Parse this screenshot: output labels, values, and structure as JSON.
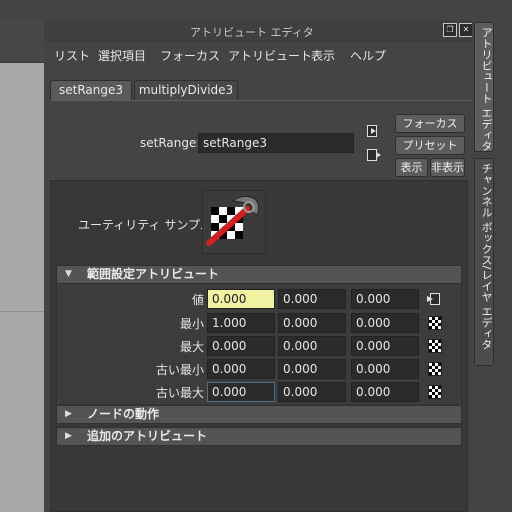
{
  "window": {
    "title": "アトリビュート エディタ"
  },
  "menu": [
    "リスト",
    "選択項目",
    "フォーカス",
    "アトリビュート",
    "表示",
    "ヘルプ"
  ],
  "tabs": [
    "setRange3",
    "multiplyDivide3"
  ],
  "node": {
    "label": "setRange:",
    "value": "setRange3"
  },
  "buttons": {
    "focus": "フォーカス",
    "preset": "プリセット",
    "show": "表示",
    "hide": "非表示"
  },
  "utility_label": "ユーティリティ サンプル",
  "sections": {
    "range": "範囲設定アトリビュート",
    "node_behavior": "ノードの動作",
    "extra": "追加のアトリビュート"
  },
  "rows": [
    {
      "label": "値",
      "values": [
        "0.000",
        "0.000",
        "0.000"
      ]
    },
    {
      "label": "最小",
      "values": [
        "1.000",
        "0.000",
        "0.000"
      ]
    },
    {
      "label": "最大",
      "values": [
        "0.000",
        "0.000",
        "0.000"
      ]
    },
    {
      "label": "古い最小",
      "values": [
        "0.000",
        "0.000",
        "0.000"
      ]
    },
    {
      "label": "古い最大",
      "values": [
        "0.000",
        "0.000",
        "0.000"
      ]
    }
  ],
  "side_tabs": [
    "アトリビュート エディタ",
    "チャンネル ボックス/レイヤ エディタ"
  ]
}
